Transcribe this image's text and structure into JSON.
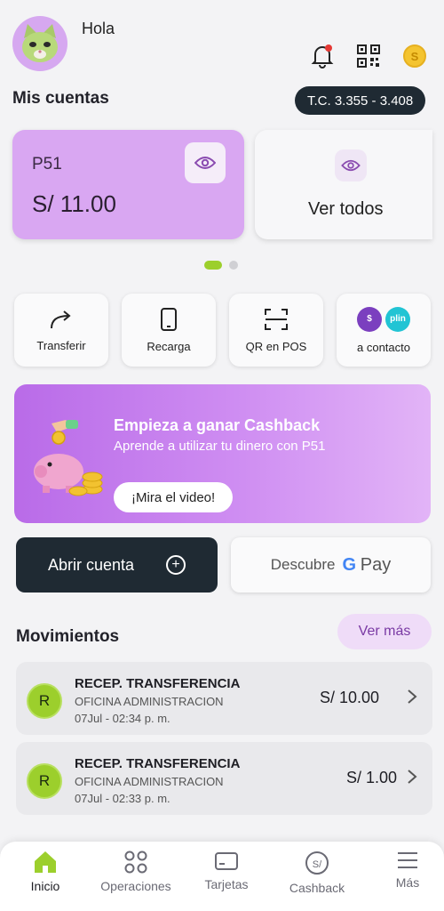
{
  "header": {
    "greeting": "Hola",
    "avatar_icon": "cat-avatar-icon",
    "icons": [
      "bell-icon",
      "qr-icon",
      "coin-icon"
    ],
    "coin_glyph": "S"
  },
  "accounts": {
    "title": "Mis cuentas",
    "exchange_rate": "T.C. 3.355 - 3.408",
    "card": {
      "name": "P51",
      "balance": "S/ 11.00"
    },
    "see_all": "Ver todos"
  },
  "quick_actions": [
    {
      "label": "Transferir",
      "icon": "share-arrow-icon"
    },
    {
      "label": "Recarga",
      "icon": "phone-icon"
    },
    {
      "label": "QR en POS",
      "icon": "scan-icon"
    },
    {
      "label": "a contacto",
      "icon": "plin-icon",
      "badge": "plin"
    }
  ],
  "banner": {
    "title": "Empieza a ganar Cashback",
    "subtitle": "Aprende a utilizar tu dinero con P51",
    "button": "¡Mira el video!"
  },
  "buttons": {
    "open_account": "Abrir cuenta",
    "discover": "Descubre",
    "gpay_g": "G",
    "gpay_pay": "Pay"
  },
  "movements": {
    "title": "Movimientos",
    "see_more": "Ver más",
    "items": [
      {
        "initial": "R",
        "title": "RECEP. TRANSFERENCIA",
        "subtitle": "OFICINA ADMINISTRACION",
        "date": "07Jul - 02:34 p. m.",
        "amount": "S/ 10.00"
      },
      {
        "initial": "R",
        "title": "RECEP. TRANSFERENCIA",
        "subtitle": "OFICINA ADMINISTRACION",
        "date": "07Jul - 02:33 p. m.",
        "amount": "S/ 1.00"
      }
    ]
  },
  "nav": [
    {
      "label": "Inicio",
      "icon": "home-icon",
      "active": true
    },
    {
      "label": "Operaciones",
      "icon": "grid-icon"
    },
    {
      "label": "Tarjetas",
      "icon": "card-icon"
    },
    {
      "label": "Cashback",
      "icon": "cashback-icon",
      "glyph": "S/"
    },
    {
      "label": "Más",
      "icon": "menu-icon"
    }
  ],
  "colors": {
    "accent_purple": "#d9a7f2",
    "accent_green": "#9ccf2c",
    "dark": "#1f2a33"
  }
}
